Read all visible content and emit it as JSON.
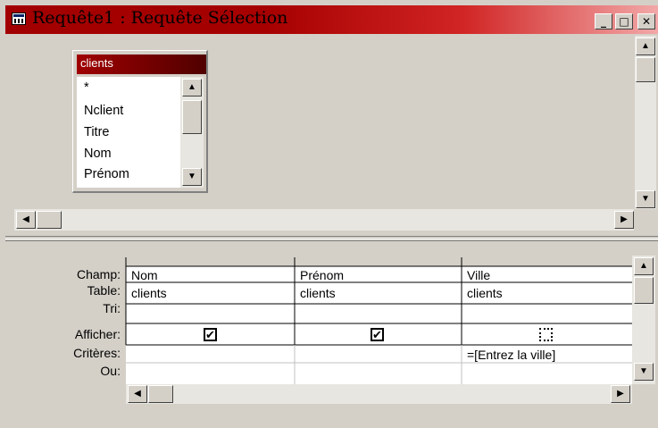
{
  "window": {
    "title": "Requête1 : Requête Sélection",
    "controls": {
      "minimize": "_",
      "maximize": "□",
      "close": "✕"
    }
  },
  "table_panel": {
    "title": "clients",
    "fields": [
      "*",
      "Nclient",
      "Titre",
      "Nom",
      "Prénom"
    ]
  },
  "grid": {
    "row_labels": {
      "champ": "Champ:",
      "table": "Table:",
      "tri": "Tri:",
      "afficher": "Afficher:",
      "criteres": "Critères:",
      "ou": "Ou:"
    },
    "columns": [
      {
        "champ": "Nom",
        "table": "clients",
        "tri": "",
        "afficher": true,
        "criteres": "",
        "ou": ""
      },
      {
        "champ": "Prénom",
        "table": "clients",
        "tri": "",
        "afficher": true,
        "criteres": "",
        "ou": ""
      },
      {
        "champ": "Ville",
        "table": "clients",
        "tri": "",
        "afficher": false,
        "criteres": "=[Entrez la ville]",
        "ou": ""
      }
    ]
  },
  "icons": {
    "app": "query-design-icon",
    "checked": "✔",
    "scroll_up": "▲",
    "scroll_down": "▼",
    "scroll_left": "◀",
    "scroll_right": "▶"
  }
}
